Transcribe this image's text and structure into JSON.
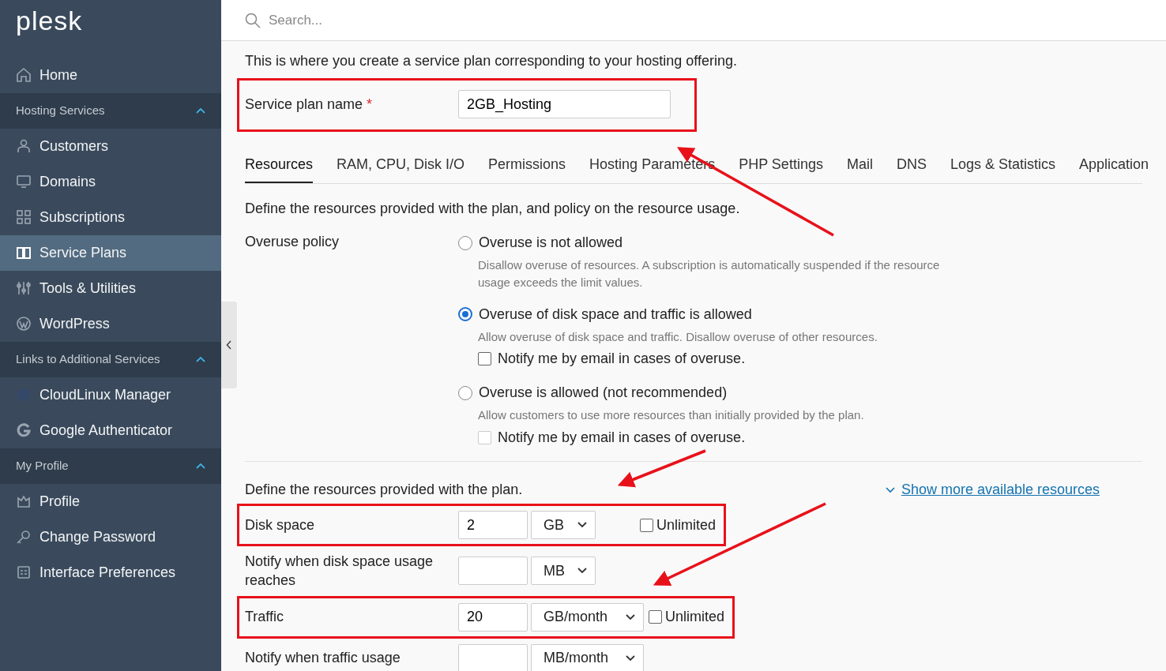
{
  "sidebar": {
    "logo": "plesk",
    "items": [
      {
        "kind": "link",
        "label": "Home",
        "selected": false
      },
      {
        "kind": "section",
        "label": "Hosting Services",
        "expanded": true,
        "children": [
          {
            "label": "Customers",
            "selected": false
          },
          {
            "label": "Domains",
            "selected": false
          },
          {
            "label": "Subscriptions",
            "selected": false
          },
          {
            "label": "Service Plans",
            "selected": true
          },
          {
            "label": "Tools & Utilities",
            "selected": false
          },
          {
            "label": "WordPress",
            "selected": false
          }
        ]
      },
      {
        "kind": "section",
        "label": "Links to Additional Services",
        "expanded": true,
        "children": [
          {
            "label": "CloudLinux Manager",
            "selected": false
          },
          {
            "label": "Google Authenticator",
            "selected": false
          }
        ]
      },
      {
        "kind": "section",
        "label": "My Profile",
        "expanded": true,
        "children": [
          {
            "label": "Profile",
            "selected": false
          },
          {
            "label": "Change Password",
            "selected": false
          },
          {
            "label": "Interface Preferences",
            "selected": false
          }
        ]
      }
    ]
  },
  "search": {
    "placeholder": "Search..."
  },
  "intro": "This is where you create a service plan corresponding to your hosting offering.",
  "plan_name": {
    "label": "Service plan name",
    "required": "*",
    "value": "2GB_Hosting",
    "highlighted": true
  },
  "tabs": [
    {
      "label": "Resources",
      "selected": true
    },
    {
      "label": "RAM, CPU, Disk I/O",
      "selected": false
    },
    {
      "label": "Permissions",
      "selected": false
    },
    {
      "label": "Hosting Parameters",
      "selected": false
    },
    {
      "label": "PHP Settings",
      "selected": false
    },
    {
      "label": "Mail",
      "selected": false
    },
    {
      "label": "DNS",
      "selected": false
    },
    {
      "label": "Logs & Statistics",
      "selected": false
    },
    {
      "label": "Application",
      "selected": false
    }
  ],
  "resources_intro": "Define the resources provided with the plan, and policy on the resource usage.",
  "overuse_policy": {
    "label": "Overuse policy",
    "options": [
      {
        "label": "Overuse is not allowed",
        "description": "Disallow overuse of resources. A subscription is automatically suspended if the resource usage exceeds the limit values.",
        "selected": false
      },
      {
        "label": "Overuse of disk space and traffic is allowed",
        "description": "Allow overuse of disk space and traffic. Disallow overuse of other resources.",
        "selected": true,
        "notify": {
          "label": "Notify me by email in cases of overuse.",
          "checked": false,
          "disabled": false
        }
      },
      {
        "label": "Overuse is allowed (not recommended)",
        "description": "Allow customers to use more resources than initially provided by the plan.",
        "selected": false,
        "notify": {
          "label": "Notify me by email in cases of overuse.",
          "checked": false,
          "disabled": true
        }
      }
    ]
  },
  "resources": {
    "intro": "Define the resources provided with the plan.",
    "show_more": "Show more available resources",
    "rows": [
      {
        "label": "Disk space",
        "value": "2",
        "unit": "GB",
        "unlimited": {
          "label": "Unlimited",
          "checked": false
        },
        "highlighted": true
      },
      {
        "label": "Notify when disk space usage reaches",
        "value": "",
        "unit": "MB",
        "highlighted": false
      },
      {
        "label": "Traffic",
        "value": "20",
        "unit": "GB/month",
        "unlimited": {
          "label": "Unlimited",
          "checked": false
        },
        "highlighted": true
      },
      {
        "label": "Notify when traffic usage",
        "value": "",
        "unit": "MB/month",
        "highlighted": false
      }
    ]
  }
}
